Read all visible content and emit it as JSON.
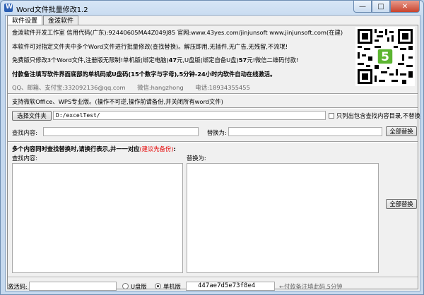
{
  "window": {
    "title": "Word文件批量修改1.2"
  },
  "tabs": [
    {
      "label": "软件设置"
    },
    {
      "label": "金泼软件"
    }
  ],
  "info": {
    "line1": "金泼软件开发工作室 信用代码(广东):92440605MA4Z049J85 官网:www.43yes.com/jinjunsoft  www.jinjunsoft.com(在建)",
    "line2": "本软件可对指定文件夹中多个Word文件进行批量修改(查找替换)。解压即用,无插件,无广告,无残留,不流氓!",
    "line3_prefix": "免费版只修改3个Word文件,注册版无限制!单机版(绑定电脑)",
    "line3_price1": "47",
    "line3_mid": "元,U盘版(绑定自备U盘)",
    "line3_price2": "57",
    "line3_suffix": "元!微信二维码付款!",
    "line4": "付款备注填写软件界面底部的单机码或U盘码(15个数字与字母),5分钟-24小时内软件自动在线激活。",
    "qq": "QQ、邮箱、支付宝:332092136@qq.com",
    "wechat": "微信:hangzhong",
    "phone": "电话:18934355455",
    "support": "支持微软Office、WPS专业版。(操作不可逆,操作前请备份,并关闭所有word文件)"
  },
  "qr": {
    "badge": "5"
  },
  "controls": {
    "choose_folder": "选择文件夹",
    "folder_path": "D:/excelTest/",
    "only_root": "只列出包含查找内容目录,不替换",
    "find_label": "查找内容:",
    "replace_label": "替换为:",
    "replace_all": "全部替换",
    "multi_title": "多个内容同时查找替换时,请换行表示,并一一对应",
    "multi_hint": "(建议先备份)",
    "multi_colon": ":",
    "multi_find_label": "查找内容:",
    "multi_replace_label": "替换为:",
    "replace_all_2": "全部替换"
  },
  "bottom": {
    "activation_label": "激活码:",
    "usb_label": "U盘版",
    "standalone_label": "单机版",
    "machine_code": "447ae7d5e73f8e4",
    "pay_note": "←付款备注填此码,5分钟"
  },
  "colors": {
    "accent_red": "#e60000"
  }
}
